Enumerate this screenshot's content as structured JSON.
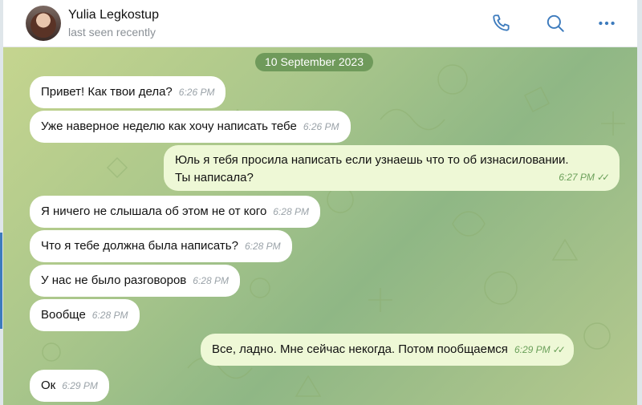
{
  "header": {
    "name": "Yulia Legkostup",
    "status": "last seen recently",
    "icons": [
      "phone-icon",
      "search-icon",
      "more-icon"
    ]
  },
  "chat": {
    "date": "10 September 2023",
    "messages": [
      {
        "dir": "in",
        "text": "Привет! Как твои дела?",
        "time": "6:26 PM"
      },
      {
        "dir": "in",
        "text": "Уже наверное неделю как хочу написать тебе",
        "time": "6:26 PM"
      },
      {
        "dir": "out",
        "line1": "Юль я тебя просила написать если узнаешь что то об изнасиловании.",
        "line2": "Ты написала?",
        "time": "6:27 PM",
        "read": true
      },
      {
        "dir": "in",
        "text": "Я ничего не слышала об этом не от кого",
        "time": "6:28 PM"
      },
      {
        "dir": "in",
        "text": "Что я тебе должна была написать?",
        "time": "6:28 PM"
      },
      {
        "dir": "in",
        "text": "У нас не было разговоров",
        "time": "6:28 PM"
      },
      {
        "dir": "in",
        "text": "Вообще",
        "time": "6:28 PM"
      },
      {
        "dir": "out",
        "text": "Все, ладно. Мне сейчас некогда. Потом пообщаемся",
        "time": "6:29 PM",
        "read": true
      },
      {
        "dir": "in",
        "text": "Ок",
        "time": "6:29 PM"
      }
    ]
  },
  "colors": {
    "incoming": "#ffffff",
    "outgoing": "#eef8d6",
    "date_pill": "#6f9a5b",
    "accent": "#3d7bbd"
  }
}
